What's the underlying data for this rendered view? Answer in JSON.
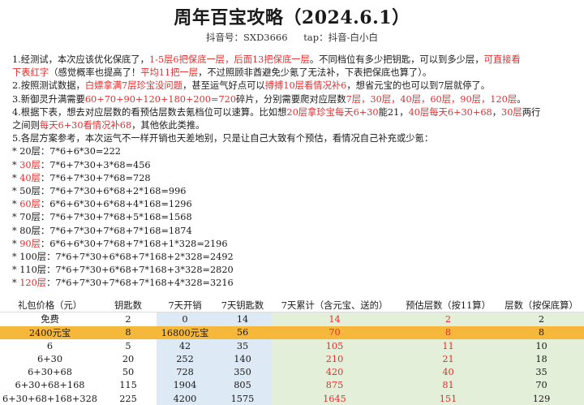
{
  "header": {
    "title": "周年百宝攻略（2024.6.1）",
    "douyin_id": "抖音号：SXD3666",
    "tap": "tap：抖音-白小白"
  },
  "notes": {
    "p1_a": "1.经测试，本次应该优化保底了，",
    "p1_b": "1-5层6把保底一层，后面13把保底一层",
    "p1_c": "。不同档位有多少把钥匙，可以到多少层，",
    "p1_d": "可直接看",
    "p1_e": "下表红字",
    "p1_f": "（感觉概率也提高了！",
    "p1_g": "平均11把一层",
    "p1_h": "，不过照顾非酋避免少氪了无法补，下表把保底也算了）。",
    "p2_a": "2.按照测试数据，",
    "p2_b": "白嫖拿满7层珍宝没问题",
    "p2_c": "，甚至运气好点可以",
    "p2_d": "搏搏10层看情况补6",
    "p2_e": "，想省元宝的也可以到7层就停了。",
    "p3_a": "3.新御灵升满需要",
    "p3_b": "60+70+90+120+180+200=720",
    "p3_c": "碎片，分别需要爬对应层数",
    "p3_d": "7层，30层，40层，60层，90层，120层",
    "p3_e": "。",
    "p4_a": "4.根据下表，想去对应层数的看预估层数去氪档位可以速算。比如想",
    "p4_b": "20层拿珍宝每天6+30",
    "p4_c": "能21，",
    "p4_d": "40层每天6+30+68",
    "p4_e": "，",
    "p4_f": "30层",
    "p4_g": "两行",
    "p4_h": "之间则",
    "p4_i": "每天6+30看情况补68",
    "p4_j": "，其他依此类推。",
    "p5": "5.各层方案参考，本次运气不一样开销也天差地别，只是让自己大致有个预估，看情况自己补充或少氪：",
    "bullets": [
      {
        "mark": "* ",
        "floor": "20层",
        "formula": "：7*6+6*30=222",
        "red": false
      },
      {
        "mark": "* ",
        "floor": "30层",
        "formula": "：7*6+7*30+3*68=456",
        "red": true
      },
      {
        "mark": "* ",
        "floor": "40层",
        "formula": "：7*6+7*30+7*68=728",
        "red": true
      },
      {
        "mark": "* ",
        "floor": "50层",
        "formula": "：7*6+7*30+6*68+2*168=996",
        "red": false
      },
      {
        "mark": "* ",
        "floor": "60层",
        "formula": "：6*6+6*30+6*68+4*168=1296",
        "red": true
      },
      {
        "mark": "* ",
        "floor": "70层",
        "formula": "：7*6+7*30+7*68+5*168=1568",
        "red": false
      },
      {
        "mark": "* ",
        "floor": "80层",
        "formula": "：7*6+7*30+7*68+7*168=1874",
        "red": false
      },
      {
        "mark": "* ",
        "floor": "90层",
        "formula": "：6*6+6*30+7*68+7*168+1*328=2196",
        "red": true
      },
      {
        "mark": "* ",
        "floor": "100层",
        "formula": "：7*6+7*30+6*68+7*168+2*328=2492",
        "red": false
      },
      {
        "mark": "* ",
        "floor": "110层",
        "formula": "：7*6+7*30+6*68+7*168+3*328=2820",
        "red": false
      },
      {
        "mark": "* ",
        "floor": "120层",
        "formula": "：7*6+7*30+7*68+7*168+4*328=3216",
        "red": true
      }
    ]
  },
  "table": {
    "headers": [
      "礼包价格（元）",
      "钥匙数",
      "7天开销",
      "7天钥匙数",
      "7天累计（含元宝、送的）",
      "预估层数（按11算）",
      "层数（按保底算）"
    ],
    "rows": [
      {
        "cells": [
          "免费",
          "2",
          "0",
          "14",
          "14",
          "2",
          "2"
        ],
        "highlight": false
      },
      {
        "cells": [
          "2400元宝",
          "8",
          "16800元宝",
          "56",
          "70",
          "8",
          "8"
        ],
        "highlight": true
      },
      {
        "cells": [
          "6",
          "5",
          "42",
          "35",
          "105",
          "11",
          "10"
        ],
        "highlight": false
      },
      {
        "cells": [
          "6+30",
          "20",
          "252",
          "140",
          "210",
          "21",
          "18"
        ],
        "highlight": false
      },
      {
        "cells": [
          "6+30+68",
          "50",
          "728",
          "350",
          "420",
          "40",
          "35"
        ],
        "highlight": false
      },
      {
        "cells": [
          "6+30+68+168",
          "115",
          "1904",
          "805",
          "875",
          "81",
          "70"
        ],
        "highlight": false
      },
      {
        "cells": [
          "6+30+68+168+328",
          "225",
          "4200",
          "1575",
          "1645",
          "151",
          "129"
        ],
        "highlight": false
      }
    ]
  },
  "colors": {
    "red_text": "#e03030",
    "highlight_row": "#f6b83a",
    "blue_cols": "#dde9f5",
    "green_cols": "#e4efd9"
  }
}
